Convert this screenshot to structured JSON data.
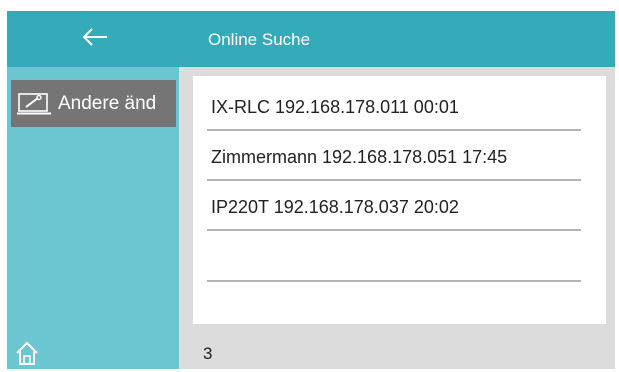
{
  "header": {
    "title": "Online Suche"
  },
  "sidebar": {
    "back_icon": "back-arrow-icon",
    "items": [
      {
        "label": "Andere änd",
        "icon": "edit-screen-icon"
      }
    ],
    "home_icon": "home-icon"
  },
  "results": [
    {
      "text": "IX-RLC 192.168.178.011 00:01"
    },
    {
      "text": "Zimmermann 192.168.178.051 17:45"
    },
    {
      "text": "IP220T 192.168.178.037 20:02"
    },
    {
      "text": ""
    }
  ],
  "footer": {
    "count": "3"
  },
  "colors": {
    "header": "#35aab8",
    "sidebar": "#6cc6d1",
    "selected_item": "#757575",
    "panel": "#dcdcdc"
  }
}
